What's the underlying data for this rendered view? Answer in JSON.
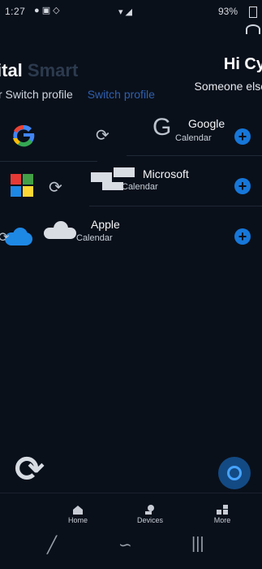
{
  "status_bar": {
    "time": "1:27",
    "battery": "93%"
  },
  "ghost_header": {
    "title": "ital",
    "title_dim": "Smart",
    "switch_text": "r Switch profile",
    "switch_link": "Switch profile"
  },
  "header": {
    "greeting": "Hi Cy",
    "subtitle": "Someone else"
  },
  "calendars": [
    {
      "name": "Google",
      "type": "Calendar",
      "icon": "google-icon"
    },
    {
      "name": "Microsoft",
      "type": "Calendar",
      "icon": "microsoft-icon"
    },
    {
      "name": "Apple",
      "type": "Calendar",
      "icon": "cloud-icon"
    }
  ],
  "tabs": [
    {
      "label": "Home",
      "icon": "home-icon"
    },
    {
      "label": "Devices",
      "icon": "devices-icon"
    },
    {
      "label": "More",
      "icon": "grid-plus-icon"
    }
  ],
  "colors": {
    "background": "#0a101a",
    "accent": "#1677d9",
    "fab": "#134a84"
  }
}
